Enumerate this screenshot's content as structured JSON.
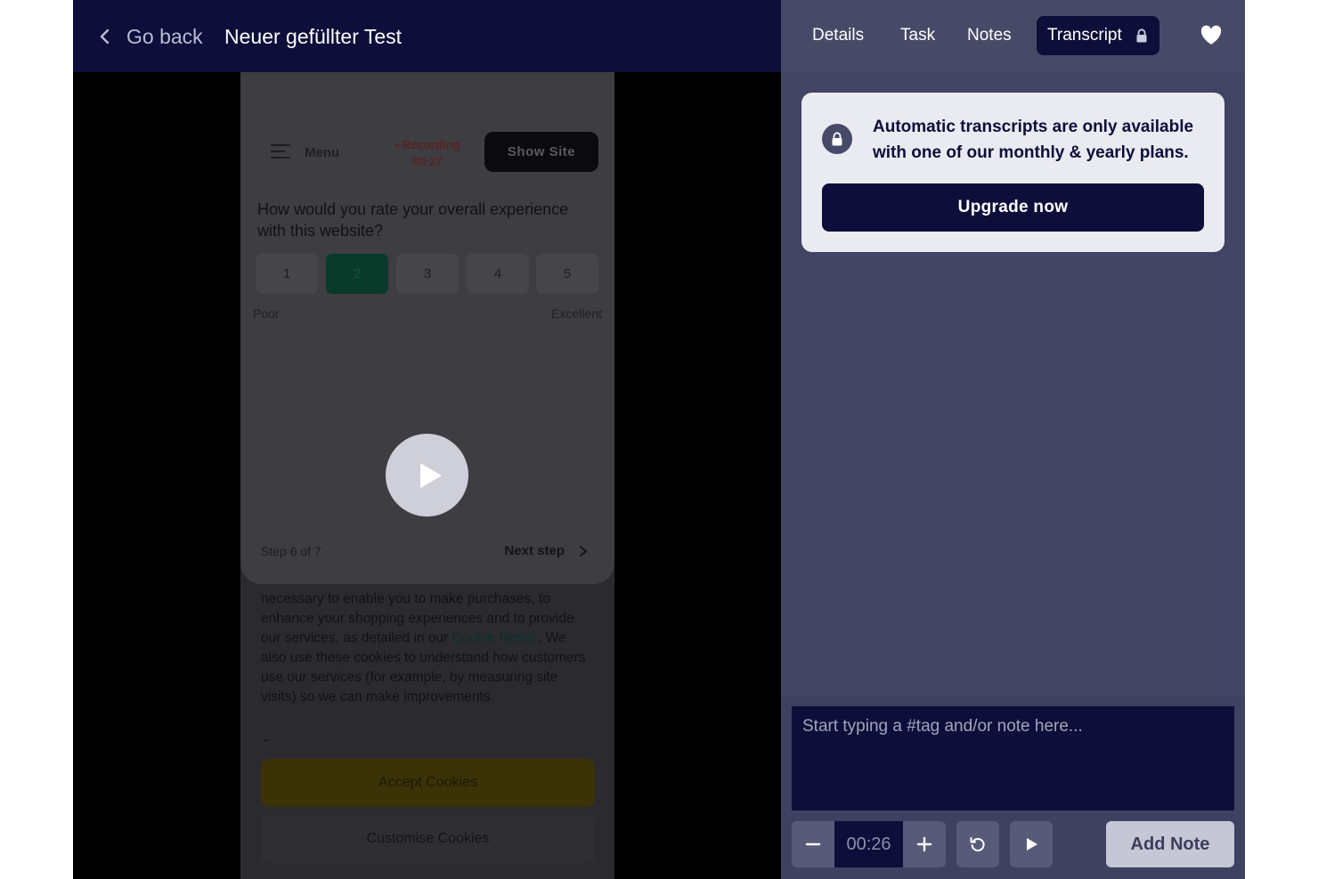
{
  "header": {
    "back_label": "Go back",
    "test_title": "Neuer gefüllter Test"
  },
  "recording": {
    "show_site_label": "Show Site",
    "menu_label": "Menu",
    "recording_label": "• Recording",
    "recording_time": "00:27",
    "question": "How would you rate your overall experience with this website?",
    "ratings": [
      "1",
      "2",
      "3",
      "4",
      "5"
    ],
    "selected_rating": "2",
    "rating_low_label": "Poor",
    "rating_high_label": "Excellent",
    "step_label": "Step 6 of 7",
    "next_step_label": "Next step",
    "cookie_text_1": "necessary to enable you to make purchases, to enhance your shopping experiences and to provide our services, as detailed in our ",
    "cookie_link": "Cookie Notice",
    "cookie_text_2": ". We also use these cookies to understand how customers use our services (for example, by measuring site visits) so we can make improvements.",
    "accept_cookies_label": "Accept Cookies",
    "customise_cookies_label": "Customise Cookies"
  },
  "tabs": {
    "details": "Details",
    "task": "Task",
    "notes": "Notes",
    "transcript": "Transcript",
    "active": "transcript"
  },
  "transcript_lock": {
    "message": "Automatic transcripts are only available with one of our monthly & yearly plans.",
    "upgrade_label": "Upgrade now"
  },
  "note_editor": {
    "placeholder": "Start typing a #tag and/or note here...",
    "timestamp": "00:26",
    "add_note_label": "Add Note"
  },
  "colors": {
    "navy": "#0d0f3a",
    "panel": "#414463",
    "selected_rating": "#0a3a2a"
  }
}
